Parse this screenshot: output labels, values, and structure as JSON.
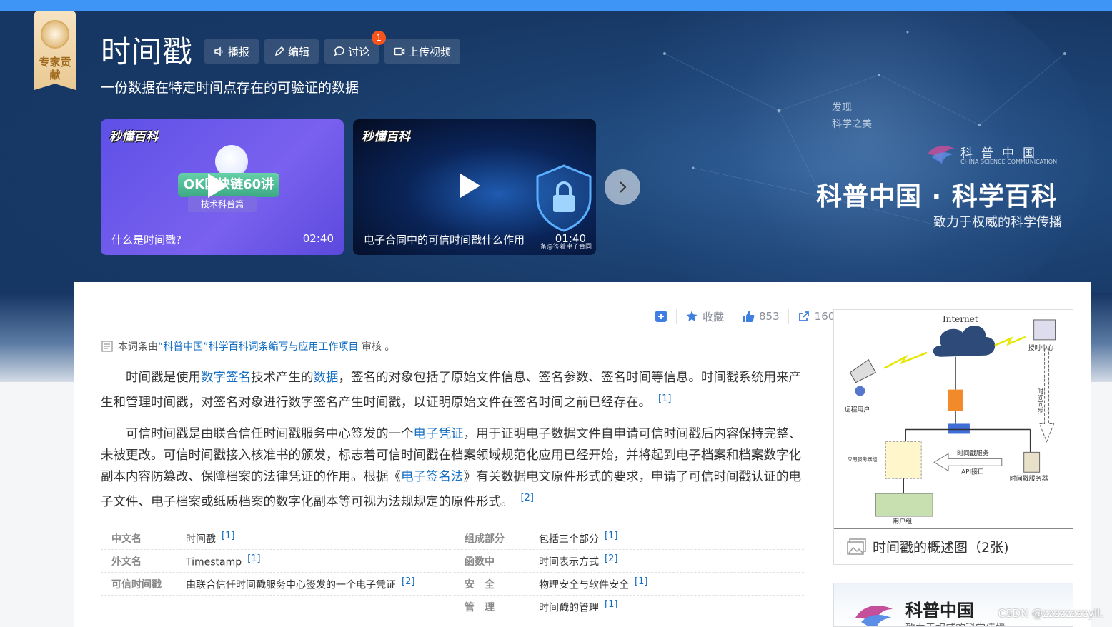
{
  "header": {
    "title": "时间戳",
    "subtitle": "一份数据在特定时间点存在的可验证的数据",
    "badge_label": "专家贡献",
    "actions": [
      {
        "label": "播报"
      },
      {
        "label": "编辑"
      },
      {
        "label": "讨论",
        "badge": "1"
      },
      {
        "label": "上传视频"
      }
    ]
  },
  "videos": [
    {
      "logo": "秒懂百科",
      "caption": "什么是时间戳?",
      "duration": "02:40",
      "banner_text": "OK区块链60讲",
      "banner_sub": "技术科普篇"
    },
    {
      "logo": "秒懂百科",
      "caption": "电子合同中的可信时间戳什么作用",
      "duration": "01:40",
      "watermark": "备@签着电子合同"
    }
  ],
  "science": {
    "small_text_1": "发现",
    "small_text_2": "科学之美",
    "brand_cn": "科普中国",
    "brand_en": "CHINA SCIENCE COMMUNICATION",
    "title": "科普中国 · 科学百科",
    "subtitle": "致力于权威的科学传播"
  },
  "toolbar": {
    "collect_label": "收藏",
    "like_count": "853",
    "share_count": "160"
  },
  "review": {
    "prefix": "本词条由",
    "link": "“科普中国”科学百科词条编写与应用工作项目",
    "suffix": "审核 。"
  },
  "paragraphs": {
    "p1": {
      "t1": "时间戳是使用",
      "l1": "数字签名",
      "t2": "技术产生的",
      "l2": "数据",
      "t3": "，签名的对象包括了原始文件信息、签名参数、签名时间等信息。时间戳系统用来产生和管理时间戳，对签名对象进行数字签名产生时间戳，以证明原始文件在签名时间之前已经存在。",
      "ref": "[1]"
    },
    "p2": {
      "t1": "可信时间戳是由联合信任时间戳服务中心签发的一个",
      "l1": "电子凭证",
      "t2": "，用于证明电子数据文件自申请可信时间戳后内容保持完整、未被更改。可信时间戳接入核准书的颁发，标志着可信时间戳在档案领域规范化应用已经开始，并将起到电子档案和档案数字化副本内容防篡改、保障档案的法律凭证的作用。根据《",
      "l2": "电子签名法",
      "t3": "》有关数据电文原件形式的要求，申请了可信时间戳认证的电子文件、电子档案或纸质档案的数字化副本等可视为法规规定的原件形式。",
      "ref": "[2]"
    }
  },
  "infobox": {
    "left": [
      {
        "key": "中文名",
        "value": "时间戳",
        "ref": "[1]"
      },
      {
        "key": "外文名",
        "value": "Timestamp",
        "ref": "[1]"
      },
      {
        "key": "可信时间戳",
        "value": "由联合信任时间戳服务中心签发的一个电子凭证",
        "ref": "[2]"
      }
    ],
    "right": [
      {
        "key": "组成部分",
        "value": "包括三个部分",
        "ref": "[1]"
      },
      {
        "key": "函数中",
        "value": "时间表示方式",
        "ref": "[2]"
      },
      {
        "key": "安　全",
        "value": "物理安全与软件安全",
        "ref": "[1]"
      },
      {
        "key": "管　理",
        "value": "时间戳的管理",
        "ref": "[1]"
      }
    ]
  },
  "sidebar": {
    "diagram": {
      "internet": "Internet",
      "timing_center": "授时中心",
      "remote_user": "远程用户",
      "timing_sync": "时间同步",
      "app_servers": "应用服务器组",
      "ts_service": "时间戳服务",
      "api": "API接口",
      "ts_server": "时间戳服务器",
      "user_group": "用户组"
    },
    "image_caption": "时间戳的概述图（2张)",
    "card_title": "科普中国",
    "card_sub": "致力于权威的科学传播"
  },
  "watermark": "CSDN @zzzzzzzzyll.",
  "colors": {
    "accent": "#3e95f5",
    "banner": "#163563",
    "link": "#136ec2",
    "notification": "#f5551c"
  }
}
